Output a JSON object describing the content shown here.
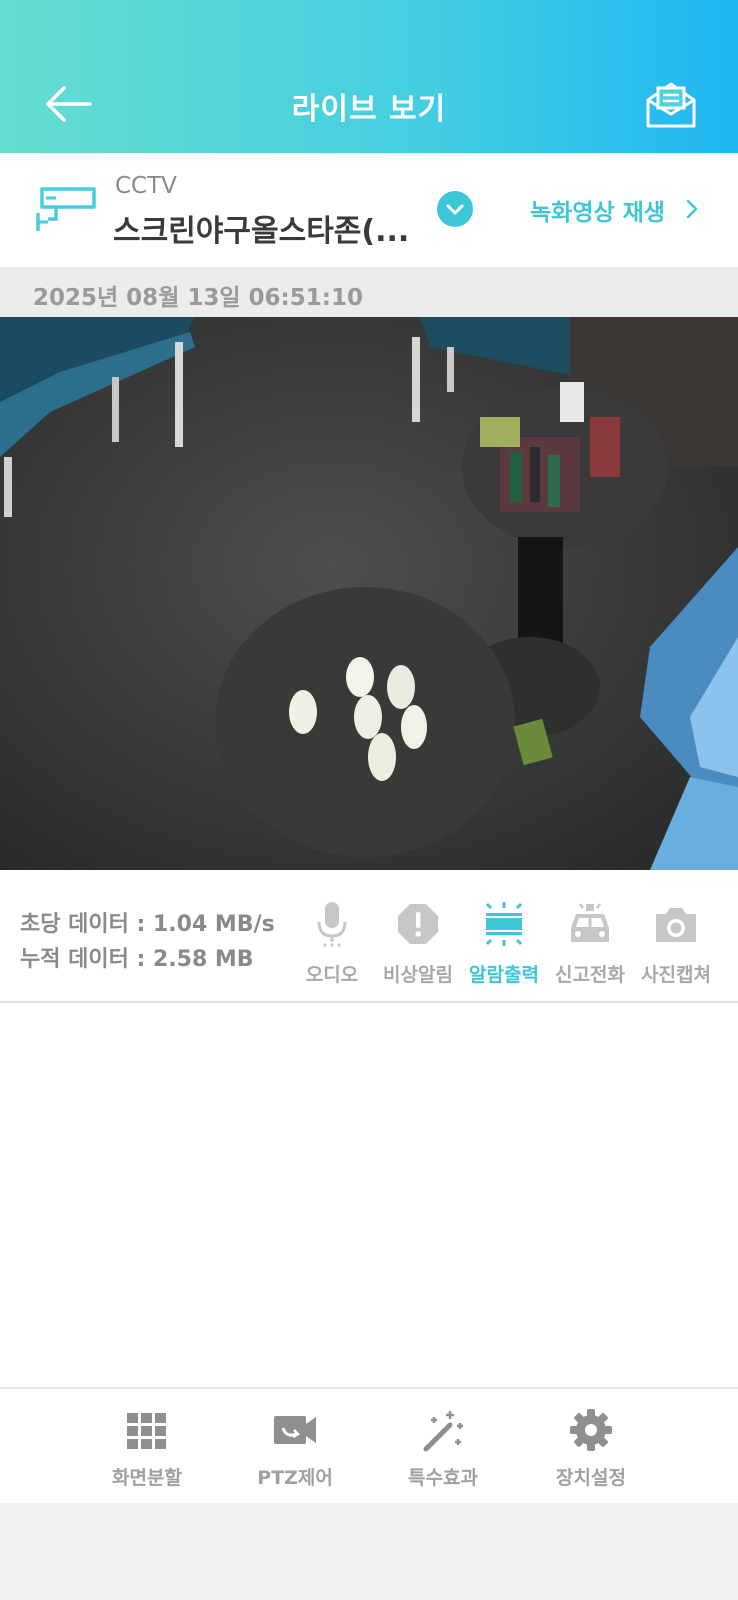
{
  "header": {
    "title": "라이브 보기",
    "back_icon": "arrow-left-icon",
    "mail_icon": "mail-open-icon"
  },
  "camera": {
    "type": "CCTV",
    "name": "스크린야구올스타존(...",
    "replay_label": "녹화영상 재생"
  },
  "timestamp": "2025년 08월 13일 06:51:10",
  "stats": {
    "rate": "초당 데이터 : 1.04 MB/s",
    "total": "누적 데이터 : 2.58 MB"
  },
  "controls": [
    {
      "label": "오디오",
      "icon": "microphone-icon",
      "active": false
    },
    {
      "label": "비상알림",
      "icon": "alert-icon",
      "active": false
    },
    {
      "label": "알람출력",
      "icon": "alarm-output-icon",
      "active": true
    },
    {
      "label": "신고전화",
      "icon": "police-car-icon",
      "active": false
    },
    {
      "label": "사진캡쳐",
      "icon": "camera-icon",
      "active": false
    }
  ],
  "bottom_nav": [
    {
      "label": "화면분할",
      "icon": "grid-icon"
    },
    {
      "label": "PTZ제어",
      "icon": "ptz-camera-icon"
    },
    {
      "label": "특수효과",
      "icon": "magic-wand-icon"
    },
    {
      "label": "장치설정",
      "icon": "gear-icon"
    }
  ],
  "colors": {
    "accent": "#3fc6d6",
    "header_start": "#66ddd0",
    "header_end": "#1fb6f2",
    "inactive": "#a8a8a8"
  }
}
